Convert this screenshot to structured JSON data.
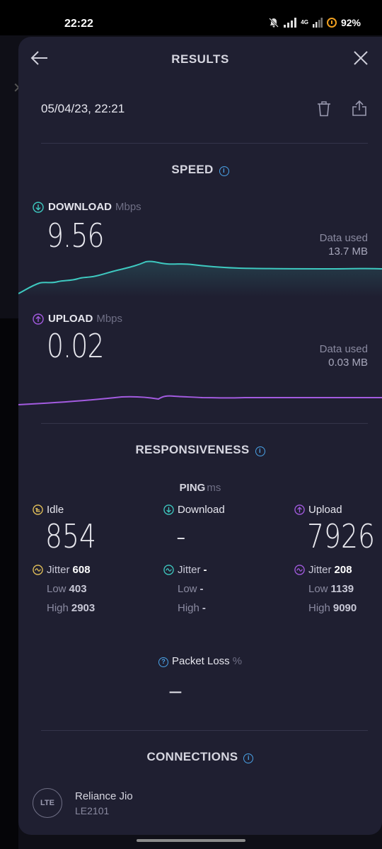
{
  "status_bar": {
    "time": "22:22",
    "network_label": "4G",
    "battery": "92%"
  },
  "header": {
    "title": "RESULTS"
  },
  "result": {
    "date": "05/04/23, 22:21"
  },
  "speed": {
    "title": "SPEED",
    "download": {
      "label": "DOWNLOAD",
      "unit": "Mbps",
      "value": "9.56",
      "data_used_label": "Data used",
      "data_used_value": "13.7 MB",
      "color": "#3ec9c0"
    },
    "upload": {
      "label": "UPLOAD",
      "unit": "Mbps",
      "value": "0.02",
      "data_used_label": "Data used",
      "data_used_value": "0.03 MB",
      "color": "#a35be0"
    }
  },
  "responsiveness": {
    "title": "RESPONSIVENESS",
    "ping_label": "PING",
    "ping_unit": "ms",
    "idle": {
      "label": "Idle",
      "value": "854",
      "jitter_label": "Jitter",
      "jitter": "608",
      "low_label": "Low",
      "low": "403",
      "high_label": "High",
      "high": "2903"
    },
    "download": {
      "label": "Download",
      "value": "-",
      "jitter_label": "Jitter",
      "jitter": "-",
      "low_label": "Low",
      "low": "-",
      "high_label": "High",
      "high": "-"
    },
    "upload": {
      "label": "Upload",
      "value": "7926",
      "jitter_label": "Jitter",
      "jitter": "208",
      "low_label": "Low",
      "low": "1139",
      "high_label": "High",
      "high": "9090"
    },
    "packet_loss": {
      "label": "Packet Loss",
      "unit": "%",
      "value": "–"
    }
  },
  "connections": {
    "title": "CONNECTIONS",
    "badge": "LTE",
    "provider": "Reliance Jio",
    "device": "LE2101"
  },
  "icons": {
    "back": "arrow-left-icon",
    "close": "close-icon",
    "trash": "trash-icon",
    "share": "share-icon",
    "info": "info-icon"
  }
}
